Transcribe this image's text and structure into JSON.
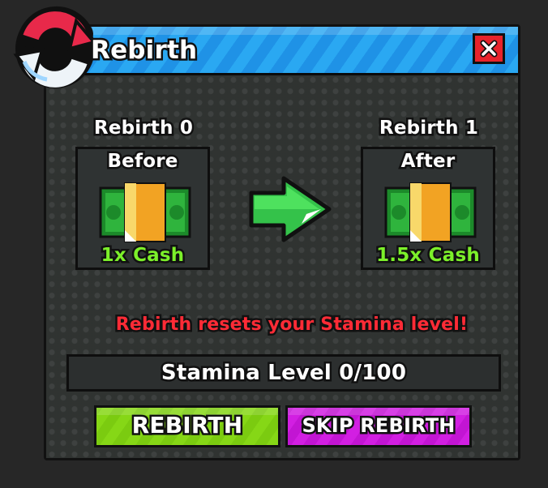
{
  "window": {
    "title": "Rebirth",
    "close_icon": "close-x-icon",
    "logo_icon": "rebirth-cycle-icon"
  },
  "before": {
    "rebirth_label": "Rebirth 0",
    "card_label": "Before",
    "multiplier": "1x Cash",
    "icon": "cash-stack-icon"
  },
  "arrow_icon": "arrow-right-icon",
  "after": {
    "rebirth_label": "Rebirth 1",
    "card_label": "After",
    "multiplier": "1.5x Cash",
    "icon": "cash-stack-icon"
  },
  "warning": "Rebirth resets your Stamina level!",
  "stamina": {
    "text": "Stamina Level 0/100",
    "current": 0,
    "max": 100
  },
  "buttons": {
    "rebirth": "REBIRTH",
    "skip": "SKIP REBIRTH"
  },
  "colors": {
    "header": "#2aa8f2",
    "close": "#e8232b",
    "rebirth_button": "#86d716",
    "skip_button": "#d21fe2",
    "warning": "#ff2b36",
    "cash_text": "#7cf02a"
  }
}
